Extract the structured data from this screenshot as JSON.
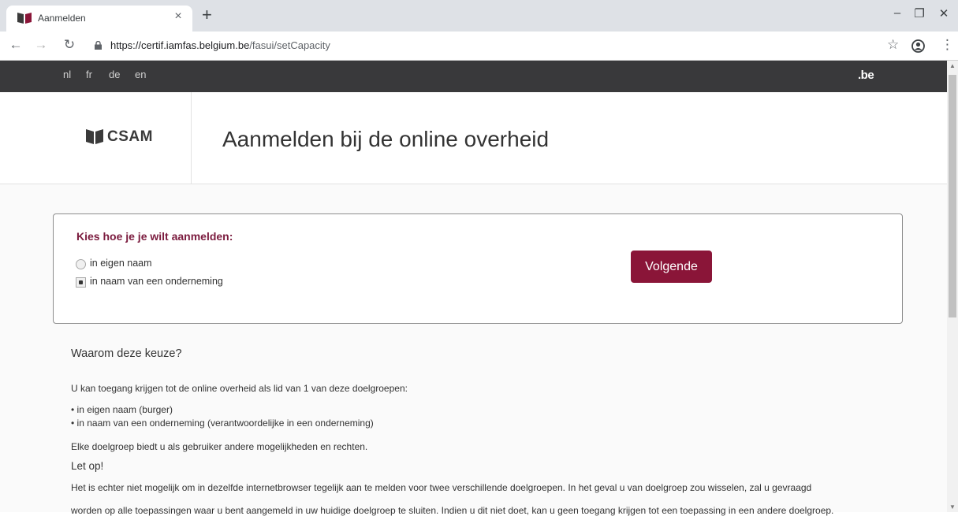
{
  "browser": {
    "tab_title": "Aanmelden",
    "tab_close": "×",
    "new_tab": "+",
    "url_host": "https://certif.iamfas.belgium.be",
    "url_path": "/fasui/setCapacity"
  },
  "site": {
    "languages": [
      "nl",
      "fr",
      "de",
      "en"
    ],
    "be_logo": ".be",
    "brand": "CSAM",
    "page_title": "Aanmelden bij de online overheid"
  },
  "capacity": {
    "heading": "Kies hoe je je wilt aanmelden:",
    "options": [
      {
        "label": "in eigen naam",
        "checked": false
      },
      {
        "label": "in naam van een onderneming",
        "checked": true
      }
    ],
    "next_button": "Volgende"
  },
  "info": {
    "why_heading": "Waarom deze keuze?",
    "intro": "U kan toegang krijgen tot de online overheid als lid van 1 van deze doelgroepen:",
    "groups": [
      "in eigen naam (burger)",
      "in naam van een onderneming (verantwoordelijke in een onderneming)"
    ],
    "rights": "Elke doelgroep biedt u als gebruiker andere mogelijkheden en rechten.",
    "warning_heading": "Let op!",
    "warning_line1": "Het is echter niet mogelijk om in dezelfde internetbrowser tegelijk aan te melden voor twee verschillende doelgroepen. In het geval u van doelgroep zou wisselen, zal u gevraagd",
    "warning_line2": "worden op alle toepassingen waar u bent aangemeld in uw huidige doelgroep te sluiten. Indien u dit niet doet, kan u geen toegang krijgen tot een toepassing in een andere doelgroep."
  },
  "colors": {
    "accent": "#8a1538",
    "heading": "#7b1b3e",
    "topbar": "#39393b"
  }
}
